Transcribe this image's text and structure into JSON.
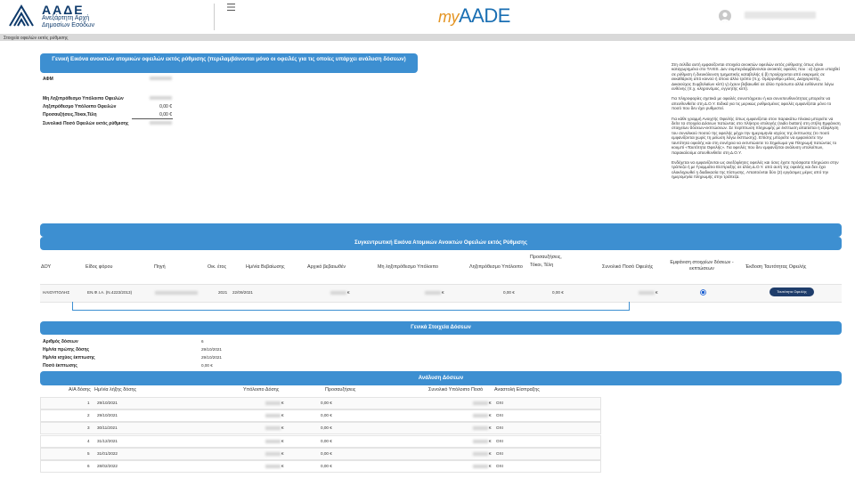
{
  "header": {
    "logo_title": "ΑΑΔΕ",
    "logo_subtitle": "Ανεξάρτητη Αρχή Δημοσίων Εσόδων",
    "brand_my": "my",
    "brand_main": "AADE",
    "menu_icon": "hamburger-icon",
    "user_icon": "user-avatar-icon"
  },
  "breadcrumb": "Στοιχεία οφειλών εκτός ρύθμισης",
  "overview": {
    "title": "Γενική Εικόνα ανοικτών ατομικών οφειλών εκτός ρύθμισης (περιλαμβάνονται μόνο οι οφειλές για τις οποίες υπάρχει ανάλυση δόσεων)",
    "rows": [
      {
        "label": "ΑΦΜ",
        "value": ""
      },
      {
        "label": "Μη Ληξιπρόθεσμο Υπόλοιπο Οφειλών",
        "value": ""
      },
      {
        "label": "Ληξιπρόθεσμο Υπόλοιπο Οφειλών",
        "value": "0,00 €"
      },
      {
        "label": "Προσαυξήσεις,Τόκοι,Τέλη",
        "value": "0,00 €"
      },
      {
        "label": "Συνολικό Ποσό Οφειλών εκτός ρύθμισης",
        "value": ""
      }
    ]
  },
  "info_paragraphs": [
    "Στη σελίδα αυτή εμφανίζονται στοιχεία ανοικτών οφειλών εκτός ρύθμισης όπως είναι καταχωρημένα στο TAXIS. Δεν συμπεριλαμβάνονται ανοικτές οφειλές που : α) έχουν υπαχθεί σε ρύθμιση ή διευκόλυνση τμηματικής καταβολής ή β) προέρχονται από εκκρεμείς σε εκκαθάριση από κοινού ή όποιο άλλο τρόπο (π.χ. Ομόρρυθμο μέλος, Διαχειριστής, Δικαιούχος Συμβολαίων κλπ) γ) έχουν βεβαιωθεί σε άλλο πρόσωπο αλλά ευθύνεστε λόγω ευθύνης (π.χ. κληρονόμος, εγγυητής κλπ).",
    "Για πληροφορίες σχετικά με οφειλές συνυπόχρεου ή και συνυπευθυνότητας μπορείτε να απευθυνθείτε στη Δ.Ο.Υ. Ειδικά για τις μερικώς ρυθμισμένες οφειλές εμφανίζεται μόνο το ποσό που δεν έχει ρυθμιστεί.",
    "Για κάθε γραμμή Ανοιχτής Οφειλής όπως εμφανίζεται στον παρακάτω πίνακα μπορείτε να δείτε τα στοιχεία Δόσεων πατώντας στο πλήκτρο επιλογής (radio button) στη στήλη Εμφάνιση στοιχείων δόσεων-εκπτώσεων. Σε περίπτωση πληρωμής με έκπτωση απαιτείται η εξόφληση του συνολικού ποσού της οφειλής μέχρι την ημερομηνία ισχύος της έκπτωσης (το ποσό εμφανίζονται χωρίς τη μείωση λόγω έκπτωσης). Επίσης μπορείτε να εμφανίσετε την ταυτότητα οφειλής και στη συνέχεια να εκτυπώσετε το Σημείωμα για Πληρωμή πατώντας το κουμπί «Ταυτότητα Οφειλής». Για οφειλές που δεν εμφανίζεται ανάλυση υπολοίπων, παρακαλούμε απευθυνθείτε στη Δ.Ο.Υ.",
    "Ενδέχεται να εμφανίζονται ως ανεξόφλητες οφειλές και όσες έχετε πρόσφατα πληρώσει στην τράπεζα ή με Γραμμάτιο Είσπραξης σε άλλη Δ.Ο.Υ. από αυτή της οφειλής και δεν έχει ολοκληρωθεί η διαδικασία της πίστωσης. Απαιτούνται δύο (2) εργάσιμες μέρες από την ημερομηνία πληρωμής στην τράπεζα."
  ],
  "summary": {
    "title": "Συγκεντρωτική Εικόνα Ατομικών Ανοικτών Οφειλών εκτός Ρύθμισης",
    "columns": [
      "ΔΟΥ",
      "Είδος φόρου",
      "Πηγή",
      "Οικ. έτος",
      "Ημ/νία Βεβαίωσης",
      "Αρχικό βεβαιωθέν",
      "Μη ληξιπρόθεσμο Υπόλοιπο",
      "Ληξιπρόθεσμο Υπόλοιπο",
      "Προσαυξήσεις, Τόκοι, Τέλη",
      "Συνολικό Ποσό Οφειλής",
      "Εμφάνιση στοιχείων δόσεων - εκπτώσεων",
      "Έκδοση Ταυτότητας Οφειλής"
    ],
    "row": {
      "dou": "ΗΛΙΟΥΠΟΛΗΣ",
      "tax_type": "ΕΝ.Φ.Ι.Α. (Ν.4223/2013)",
      "source": "",
      "fiscal_year": "2021",
      "certification_date": "22/09/2021",
      "initial_amount": "€",
      "non_overdue": "€",
      "overdue": "0,00 €",
      "surcharges": "0,00 €",
      "total": "€",
      "button_label": "Ταυτότητα Οφειλής"
    }
  },
  "installments_info": {
    "title": "Γενικά Στοιχεία Δόσεων",
    "rows": [
      {
        "label": "Αριθμός δόσεων",
        "value": "6"
      },
      {
        "label": "Ημ/νία πρώτης δόσης",
        "value": "29/10/2021"
      },
      {
        "label": "Ημ/νία ισχύος έκπτωσης",
        "value": "29/10/2021"
      },
      {
        "label": "Ποσό έκπτωσης",
        "value": "0,00 €"
      }
    ]
  },
  "analysis": {
    "title": "Ανάλυση Δόσεων",
    "columns": [
      "Α/Α δόσης",
      "Ημ/νία λήξης δόσης",
      "Υπόλοιπο Δόσης",
      "Προσαυξήσεις",
      "Συνολικό Υπόλοιπο Ποσό",
      "Αναστολή Είσπραξης"
    ],
    "rows": [
      {
        "no": "1",
        "date": "29/10/2021",
        "balance": "€",
        "surcharges": "0,00 €",
        "total": "€",
        "suspension": "ΟΧΙ"
      },
      {
        "no": "2",
        "date": "29/10/2021",
        "balance": "€",
        "surcharges": "0,00 €",
        "total": "€",
        "suspension": "ΟΧΙ"
      },
      {
        "no": "3",
        "date": "30/11/2021",
        "balance": "€",
        "surcharges": "0,00 €",
        "total": "€",
        "suspension": "ΟΧΙ"
      },
      {
        "no": "4",
        "date": "31/12/2021",
        "balance": "€",
        "surcharges": "0,00 €",
        "total": "€",
        "suspension": "ΟΧΙ"
      },
      {
        "no": "5",
        "date": "31/01/2022",
        "balance": "€",
        "surcharges": "0,00 €",
        "total": "€",
        "suspension": "ΟΧΙ"
      },
      {
        "no": "6",
        "date": "28/02/2022",
        "balance": "€",
        "surcharges": "0,00 €",
        "total": "€",
        "suspension": "ΟΧΙ"
      }
    ]
  },
  "colors": {
    "accent": "#3d8fd1",
    "brand": "#0e3a6b",
    "button": "#1f3d6b"
  }
}
